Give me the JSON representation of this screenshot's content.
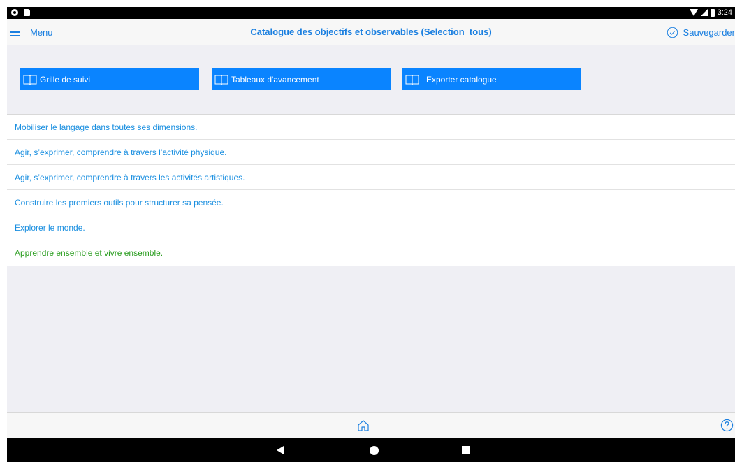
{
  "status_bar": {
    "time": "3:24",
    "icons": [
      "notification-dot-icon",
      "sd-card-icon",
      "wifi-icon",
      "signal-icon",
      "battery-icon"
    ]
  },
  "nav": {
    "menu_label": "Menu",
    "title": "Catalogue des objectifs et observables (Selection_tous)",
    "save_label": "Sauvegarder"
  },
  "actions": [
    {
      "label": "Grille de suivi",
      "icon": "book-icon"
    },
    {
      "label": "Tableaux d'avancement",
      "icon": "book-icon"
    },
    {
      "label": "Exporter catalogue",
      "icon": "book-icon"
    }
  ],
  "list": [
    {
      "label": "Mobiliser le langage dans toutes ses dimensions."
    },
    {
      "label": "Agir, s’exprimer, comprendre à travers l’activité physique."
    },
    {
      "label": "Agir, s’exprimer, comprendre à travers les activités artistiques."
    },
    {
      "label": "Construire les premiers outils pour structurer sa pensée."
    },
    {
      "label": "Explorer le monde."
    },
    {
      "label": "Apprendre ensemble et vivre ensemble."
    }
  ],
  "colors": {
    "accent": "#1a7fe0",
    "button_bg": "#0a84ff",
    "list_text": "#1a8fe0",
    "list_text_highlight": "#2a9d1f",
    "background": "#efeff4"
  },
  "toolbar": {
    "icons": [
      "home-icon",
      "help-icon"
    ]
  },
  "android_nav": {
    "icons": [
      "back-icon",
      "home-circle-icon",
      "recents-icon"
    ]
  }
}
